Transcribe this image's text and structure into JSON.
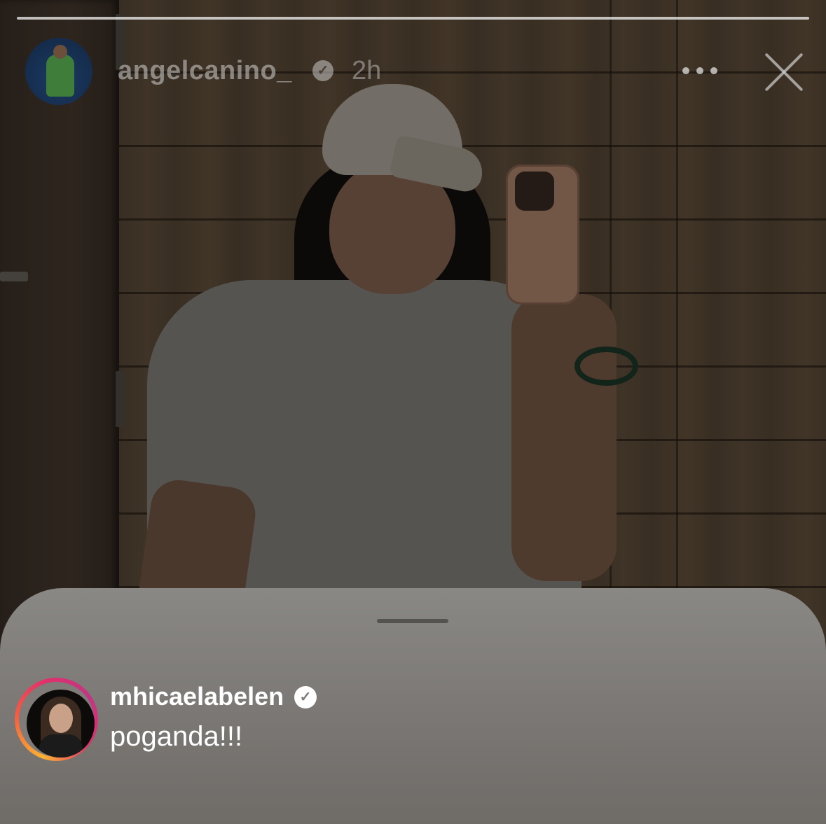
{
  "story": {
    "author": {
      "username": "angelcanino_",
      "verified_icon": "verified-badge-icon",
      "time_ago": "2h"
    },
    "progress": 1.0,
    "actions": {
      "more_icon": "more-horizontal-icon",
      "close_icon": "close-icon"
    }
  },
  "reply_sheet": {
    "comment": {
      "username": "mhicaelabelen",
      "verified_icon": "verified-badge-icon",
      "text": "poganda!!!"
    }
  },
  "colors": {
    "sheet_background": "#7d7a77",
    "story_ring_gradient": [
      "#f9b233",
      "#f56040",
      "#e1306c",
      "#c13584"
    ]
  }
}
